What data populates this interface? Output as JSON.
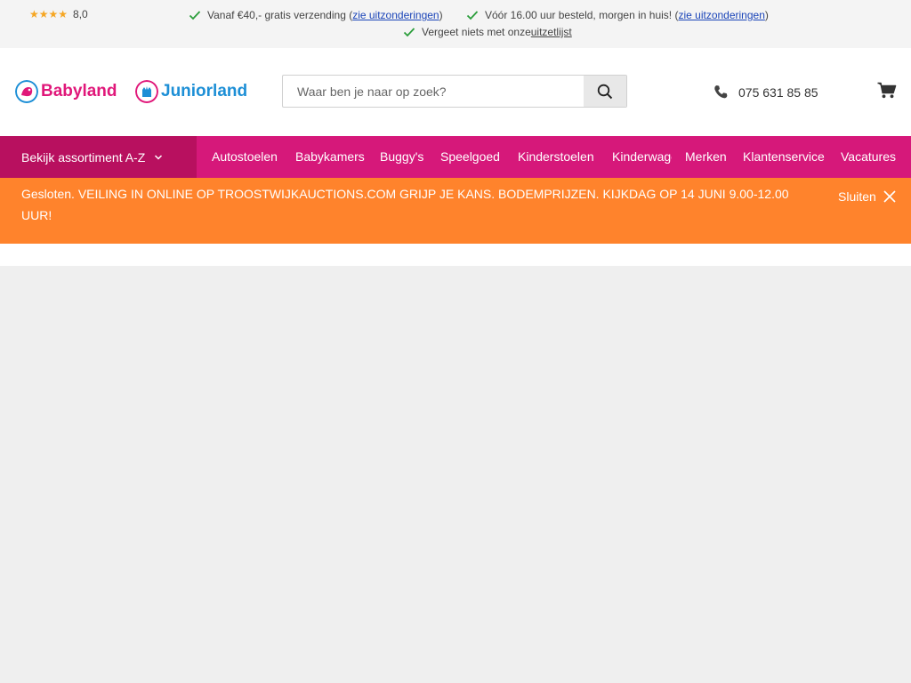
{
  "topbar": {
    "rating": {
      "stars": "★★★★",
      "score": "8,0"
    },
    "usp1": {
      "text": "Vanaf €40,- gratis verzending (",
      "link": "zie uitzonderingen",
      "close": ")"
    },
    "usp2": {
      "text": "Vóór 16.00 uur besteld, morgen in huis! (",
      "link": "zie uitzonderingen",
      "close": ")"
    },
    "usp3": {
      "text": "Vergeet niets met onze ",
      "link": "uitzetlijst"
    }
  },
  "header": {
    "logo_babyland": "Babyland",
    "logo_juniorland": "Juniorland",
    "search": {
      "placeholder": "Waar ben je naar op zoek?",
      "value": ""
    },
    "phone": "075 631 85 85",
    "icons": {
      "search": "search-icon",
      "phone": "phone-icon",
      "cart": "cart-icon",
      "check": "check-icon",
      "close": "close-icon"
    }
  },
  "nav": {
    "assortment_label": "Bekijk assortiment A-Z",
    "items": [
      "Autostoelen",
      "Babykamers",
      "Buggy's",
      "Speelgoed",
      "Kinderstoelen",
      "Kinderwagens",
      "Merken",
      "Klantenservice",
      "Vacatures"
    ]
  },
  "notice": {
    "text": "Gesloten. VEILING IN ONLINE OP TROOSTWIJKAUCTIONS.COM GRIJP JE KANS. BODEMPRIJZEN. KIJKDAG OP 14 JUNI 9.00-12.00 UUR!",
    "close_label": "Sluiten"
  },
  "colors": {
    "brand_pink": "#d6187a",
    "brand_pink_dark": "#b8105f",
    "brand_blue": "#1d8fd6",
    "notice_orange": "#ff832c",
    "check_green": "#2a9d3a",
    "star_orange": "#f5a623"
  }
}
